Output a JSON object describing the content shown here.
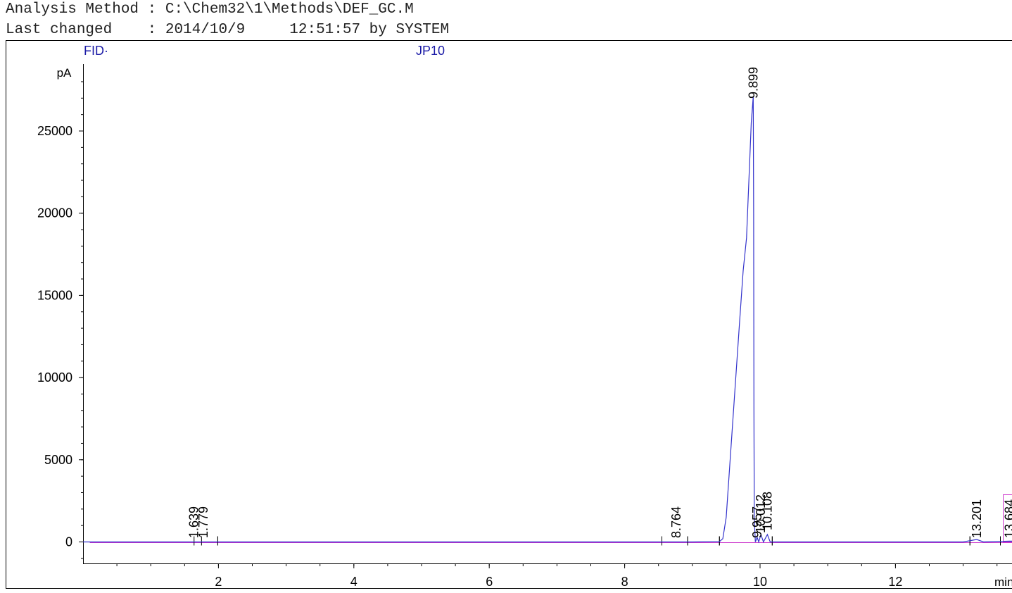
{
  "header": {
    "line1": "Analysis Method : C:\\Chem32\\1\\Methods\\DEF_GC.M",
    "line2": "Last changed    : 2014/10/9     12:51:57 by SYSTEM"
  },
  "chart_data": {
    "type": "line",
    "title": "",
    "detector_label": "FID·",
    "sample_label": "JP10",
    "ylabel": "pA",
    "xlabel": "min",
    "xlim": [
      0,
      14.1
    ],
    "ylim": [
      -1350,
      29000
    ],
    "xticks": [
      2,
      4,
      6,
      8,
      10,
      12
    ],
    "yticks": [
      0,
      5000,
      10000,
      15000,
      20000,
      25000
    ],
    "grid": false,
    "colors": {
      "signal": "#3333cc",
      "baseline": "#cc33cc",
      "labels": "#1a1aa6",
      "axis": "#000000"
    },
    "series": [
      {
        "x": [
          0,
          8.0,
          9.0,
          9.4,
          9.45,
          9.5,
          9.55,
          9.6,
          9.65,
          9.7,
          9.75,
          9.8,
          9.82,
          9.85,
          9.87,
          9.899,
          9.905,
          9.91,
          9.915,
          9.93,
          9.957,
          9.98,
          10.012,
          10.05,
          10.108,
          10.15,
          11.0,
          13.0,
          13.201,
          13.3,
          13.684,
          14.1
        ],
        "y": [
          0,
          0,
          0,
          20,
          200,
          1500,
          4500,
          7500,
          10500,
          13500,
          16500,
          18500,
          20500,
          23500,
          25500,
          27100,
          20000,
          8000,
          1500,
          0,
          280,
          0,
          450,
          0,
          450,
          0,
          0,
          0,
          150,
          0,
          50,
          0
        ]
      }
    ],
    "peaks": [
      {
        "rt": "1.639",
        "x": 1.639
      },
      {
        "rt": "1.779",
        "x": 1.779
      },
      {
        "rt": "8.764",
        "x": 8.764
      },
      {
        "rt": "9.899",
        "x": 9.899
      },
      {
        "rt": "9.957",
        "x": 9.957
      },
      {
        "rt": "10.012",
        "x": 10.012
      },
      {
        "rt": "10.108",
        "x": 10.108
      },
      {
        "rt": "13.201",
        "x": 13.201
      },
      {
        "rt": "13.684",
        "x": 13.684
      }
    ]
  }
}
